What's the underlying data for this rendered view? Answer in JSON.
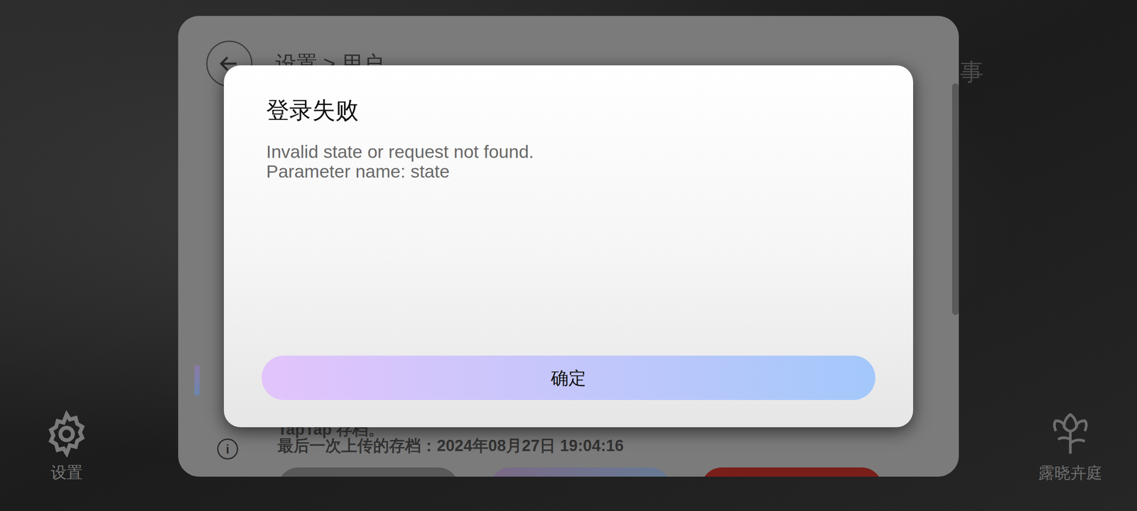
{
  "background_menu": {
    "left": {
      "label": "设置"
    },
    "right": {
      "label": "露晓卉庭"
    },
    "top_right": "事"
  },
  "settings_panel": {
    "breadcrumb": "设置 > 用户",
    "sidebar": [
      {
        "selected": false
      },
      {
        "selected": false
      },
      {
        "selected": false
      },
      {
        "selected": false
      },
      {
        "selected": true
      }
    ],
    "description": "TapTap 存档。",
    "last_upload": "最后一次上传的存档：2024年08月27日 19:04:16"
  },
  "dialog": {
    "title": "登录失败",
    "message": [
      "Invalid state or request not found.",
      "Parameter name: state"
    ],
    "buttons": [
      "确定"
    ]
  }
}
